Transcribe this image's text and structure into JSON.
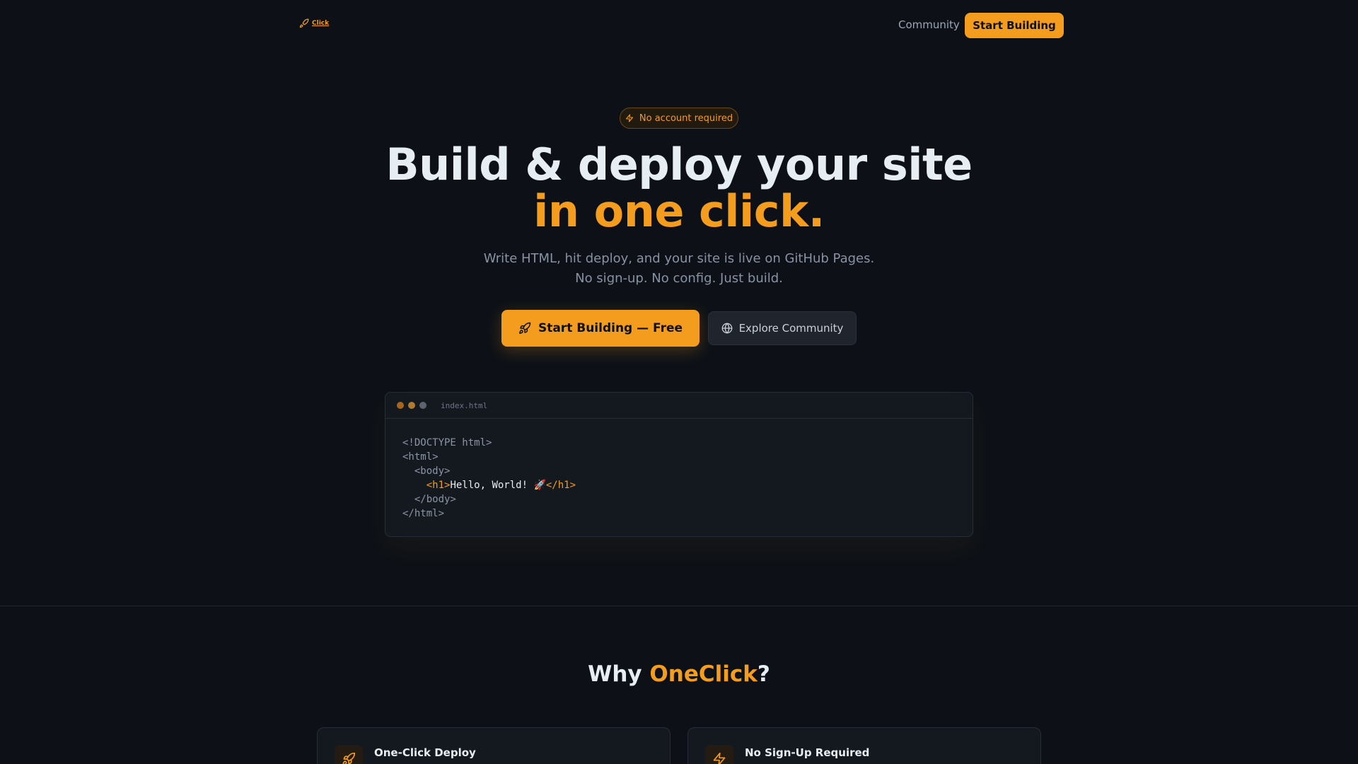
{
  "nav": {
    "logo_text": "Click",
    "community_label": "Community",
    "start_label": "Start Building"
  },
  "hero": {
    "badge": "No account required",
    "headline_line1": "Build & deploy your site",
    "headline_line2": "in one click.",
    "subtitle_line1": "Write HTML, hit deploy, and your site is live on GitHub Pages.",
    "subtitle_line2": "No sign-up. No config. Just build.",
    "primary_cta": "Start Building — Free",
    "secondary_cta": "Explore Community"
  },
  "code": {
    "filename": "index.html",
    "line1": "<!DOCTYPE html>",
    "line2": "<html>",
    "line3": "  <body>",
    "line4_open": "<h1>",
    "line4_text": "Hello, World! 🚀",
    "line4_close": "</h1>",
    "line5": "  </body>",
    "line6": "</html>"
  },
  "features": {
    "heading_prefix": "Why ",
    "heading_accent": "OneClick",
    "heading_suffix": "?",
    "cards": [
      {
        "title": "One-Click Deploy",
        "icon": "rocket-icon"
      },
      {
        "title": "No Sign-Up Required",
        "icon": "bolt-icon"
      }
    ]
  },
  "colors": {
    "background": "#0d1117",
    "accent": "#f39c1e",
    "text": "#e6edf3",
    "muted": "#8792a2"
  }
}
